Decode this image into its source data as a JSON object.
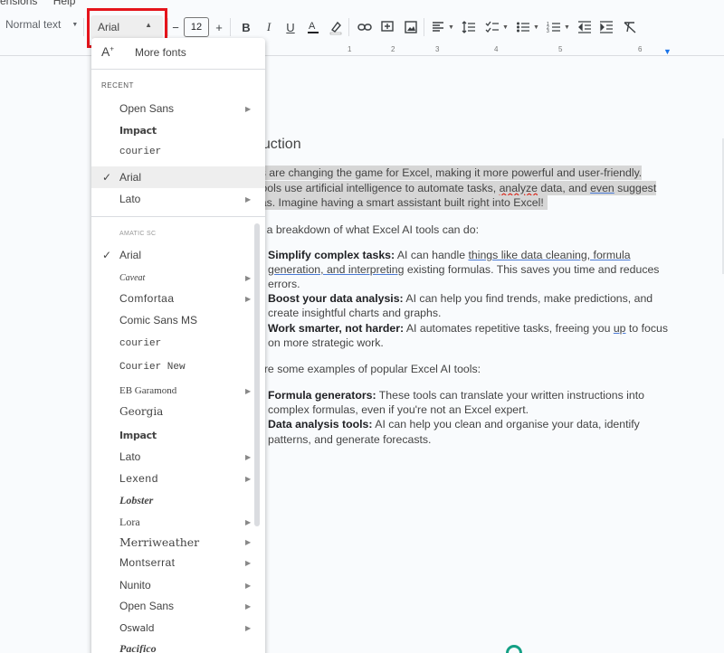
{
  "menu_remnant": [
    "ensions",
    "Help"
  ],
  "toolbar": {
    "style_label": "Normal text",
    "font_label": "Arial",
    "size_value": "12",
    "minus": "−",
    "plus": "+"
  },
  "ruler": {
    "labels": [
      "1",
      "2",
      "3",
      "4",
      "5",
      "6"
    ]
  },
  "document": {
    "heading": "duction",
    "para1": [
      "ls are changing the game for Excel, making it more powerful and user-friendly.",
      "tools use artificial intelligence to automate tasks, analyze data, and even suggest",
      "ias.  Imagine having a smart assistant built right into Excel!"
    ],
    "p1_l2_pre": "tools use artificial intelligence to automate tasks, ",
    "p1_l2_red": "analyze",
    "p1_l2_mid": " data, and ",
    "p1_l2_blue": "even",
    "p1_l2_post": " suggest",
    "breakdown": "s a breakdown of what Excel AI tools can do:",
    "b1_title": "Simplify complex tasks:",
    "b1_l1_pre": " AI can handle ",
    "b1_l1_ul": "things like data cleaning, formula",
    "b1_l2_ul": "generation, and interpreting",
    "b1_l2_post": " existing formulas. This saves you time and reduces",
    "b1_l3": "errors.",
    "b2_title": "Boost your data analysis:",
    "b2_l1": " AI can help you find trends, make predictions, and",
    "b2_l2": "create insightful charts and graphs.",
    "b3_title": "Work smarter, not harder:",
    "b3_l1_pre": " AI automates repetitive tasks, freeing you ",
    "b3_l1_ul": "up",
    "b3_l1_post": " to focus",
    "b3_l2": "on more strategic work.",
    "examples": "are some examples of popular Excel AI tools:",
    "c1_title": "Formula generators:",
    "c1_l1": " These tools can translate your written instructions into",
    "c1_l2": "complex formulas, even if you're not an Excel expert.",
    "c2_title": "Data analysis tools:",
    "c2_l1": " AI can help you clean and organise your data, identify",
    "c2_l2": "patterns, and generate forecasts."
  },
  "font_menu": {
    "more_fonts": "More fonts",
    "recent_header": "RECENT",
    "recent": [
      "Open Sans",
      "Impact",
      "courier",
      "Arial",
      "Lato"
    ],
    "all": [
      "AMATIC SC",
      "Arial",
      "Caveat",
      "Comfortaa",
      "Comic Sans MS",
      "courier",
      "Courier New",
      "EB Garamond",
      "Georgia",
      "Impact",
      "Lato",
      "Lexend",
      "Lobster",
      "Lora",
      "Merriweather",
      "Montserrat",
      "Nunito",
      "Open Sans",
      "Oswald",
      "Pacifico"
    ],
    "check": "✓",
    "arrow": "▶"
  }
}
